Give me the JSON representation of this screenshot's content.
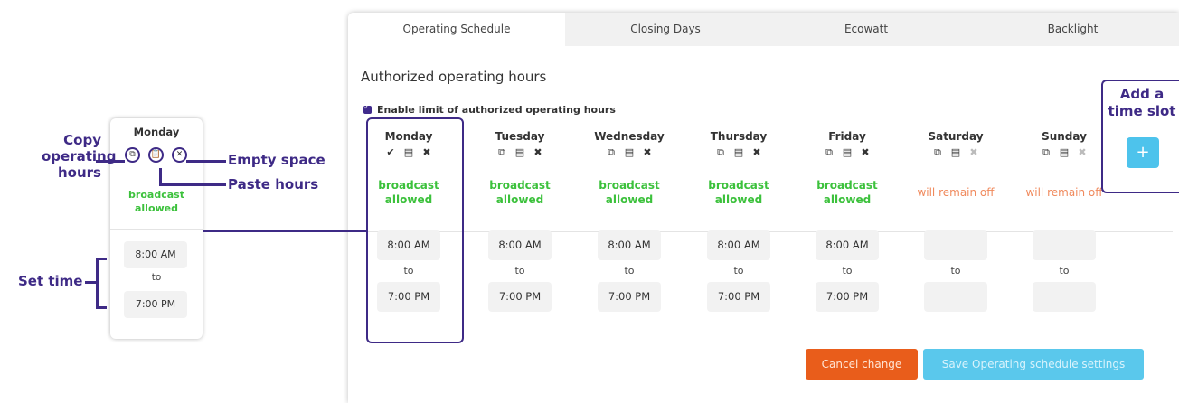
{
  "tabs": [
    {
      "label": "Operating Schedule",
      "active": true
    },
    {
      "label": "Closing Days",
      "active": false
    },
    {
      "label": "Ecowatt",
      "active": false
    },
    {
      "label": "Backlight",
      "active": false
    }
  ],
  "section_title": "Authorized operating hours",
  "enable_limit_label": "Enable limit of authorized operating hours",
  "days": [
    {
      "name": "Monday",
      "status": "broadcast allowed",
      "allowed": true,
      "start": "8:00 AM",
      "to": "to",
      "end": "7:00 PM",
      "icons": [
        "check-icon",
        "paste-icon",
        "close-icon"
      ]
    },
    {
      "name": "Tuesday",
      "status": "broadcast allowed",
      "allowed": true,
      "start": "8:00 AM",
      "to": "to",
      "end": "7:00 PM",
      "icons": [
        "copy-icon",
        "paste-icon",
        "close-icon"
      ]
    },
    {
      "name": "Wednesday",
      "status": "broadcast allowed",
      "allowed": true,
      "start": "8:00 AM",
      "to": "to",
      "end": "7:00 PM",
      "icons": [
        "copy-icon",
        "paste-icon",
        "close-icon"
      ]
    },
    {
      "name": "Thursday",
      "status": "broadcast allowed",
      "allowed": true,
      "start": "8:00 AM",
      "to": "to",
      "end": "7:00 PM",
      "icons": [
        "copy-icon",
        "paste-icon",
        "close-icon"
      ]
    },
    {
      "name": "Friday",
      "status": "broadcast allowed",
      "allowed": true,
      "start": "8:00 AM",
      "to": "to",
      "end": "7:00 PM",
      "icons": [
        "copy-icon",
        "paste-icon",
        "close-icon"
      ]
    },
    {
      "name": "Saturday",
      "status": "will remain off",
      "allowed": false,
      "start": "",
      "to": "to",
      "end": "",
      "icons": [
        "copy-icon",
        "paste-icon",
        "close-icon"
      ]
    },
    {
      "name": "Sunday",
      "status": "will remain off",
      "allowed": false,
      "start": "",
      "to": "to",
      "end": "",
      "icons": [
        "copy-icon",
        "paste-icon",
        "close-icon"
      ]
    }
  ],
  "buttons": {
    "cancel": "Cancel change",
    "save": "Save Operating schedule settings",
    "add_slot": "+"
  },
  "callouts": {
    "add_slot": "Add a time slot",
    "copy": "Copy operating hours",
    "empty": "Empty space",
    "paste": "Paste hours",
    "set_time": "Set time"
  },
  "mini_card": {
    "day": "Monday",
    "status": "broadcast allowed",
    "start": "8:00 AM",
    "to": "to",
    "end": "7:00 PM"
  },
  "colors": {
    "accent": "#3e2a86",
    "allowed": "#3cc13c",
    "off": "#f08a5d",
    "cancel": "#e95d1b",
    "save": "#5ac8ec"
  }
}
